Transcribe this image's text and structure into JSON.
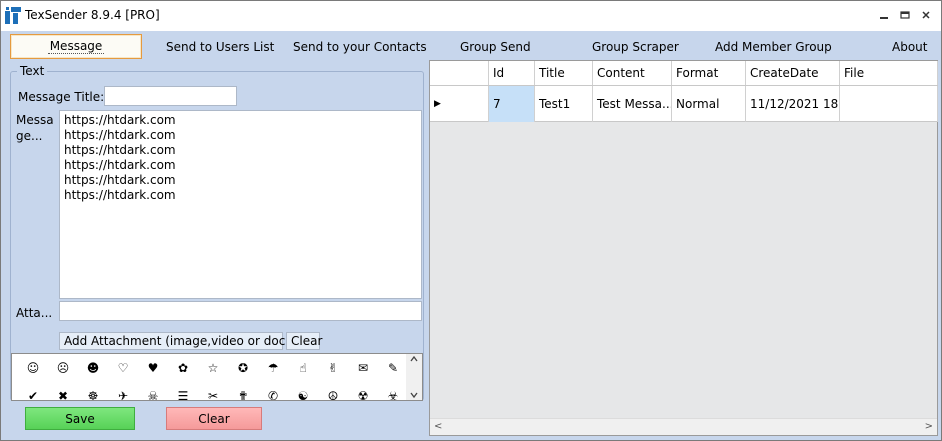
{
  "window": {
    "title": "TexSender 8.9.4 [PRO]",
    "controls": {
      "minimize": "▭",
      "restore": "❐",
      "close": "✕"
    }
  },
  "tabs": [
    {
      "label": "Message",
      "active": true
    },
    {
      "label": "Send to Users List"
    },
    {
      "label": "Send to your Contacts"
    },
    {
      "label": "Group Send"
    },
    {
      "label": "Group Scraper"
    },
    {
      "label": "Add Member Group"
    },
    {
      "label": "About"
    }
  ],
  "text_group": {
    "legend": "Text",
    "message_title_label": "Message Title:",
    "message_title_value": "",
    "message_label_line1": "Messa",
    "message_label_line2": "ge...",
    "message_lines": [
      "https://htdark.com",
      "https://htdark.com",
      "https://htdark.com",
      "https://htdark.com",
      "https://htdark.com",
      "https://htdark.com"
    ],
    "attachment_label": "Atta...",
    "attachment_value": "",
    "add_attachment_button": "Add  Attachment  (image,video  or doc...",
    "clear_attachment_button": "Clear"
  },
  "emoji_rows": [
    [
      "☺",
      "☹",
      "☻",
      "♡",
      "♥",
      "✿",
      "☆",
      "✪",
      "☂",
      "☝",
      "✌",
      "✉",
      "✎"
    ],
    [
      "✔",
      "✖",
      "☸",
      "✈",
      "☠",
      "☰",
      "✂",
      "✟",
      "✆",
      "☯",
      "☮",
      "☢",
      "☣"
    ]
  ],
  "buttons": {
    "save": "Save",
    "clear": "Clear"
  },
  "grid": {
    "columns": [
      "",
      "Id",
      "Title",
      "Content",
      "Format",
      "CreateDate",
      "File"
    ],
    "rows": [
      {
        "indicator": "▶",
        "id": "7",
        "title": "Test1",
        "content": "Test Messa...",
        "format": "Normal",
        "create_date": "11/12/2021 18...",
        "file": ""
      }
    ],
    "scroll_left": "<",
    "scroll_right": ">"
  },
  "colors": {
    "window_bg": "#c7d6ec",
    "active_tab_border": "#e59a3f",
    "save_button": "#6edc6e",
    "clear_button": "#f7a8a8",
    "selected_cell": "#c6e0f8"
  }
}
